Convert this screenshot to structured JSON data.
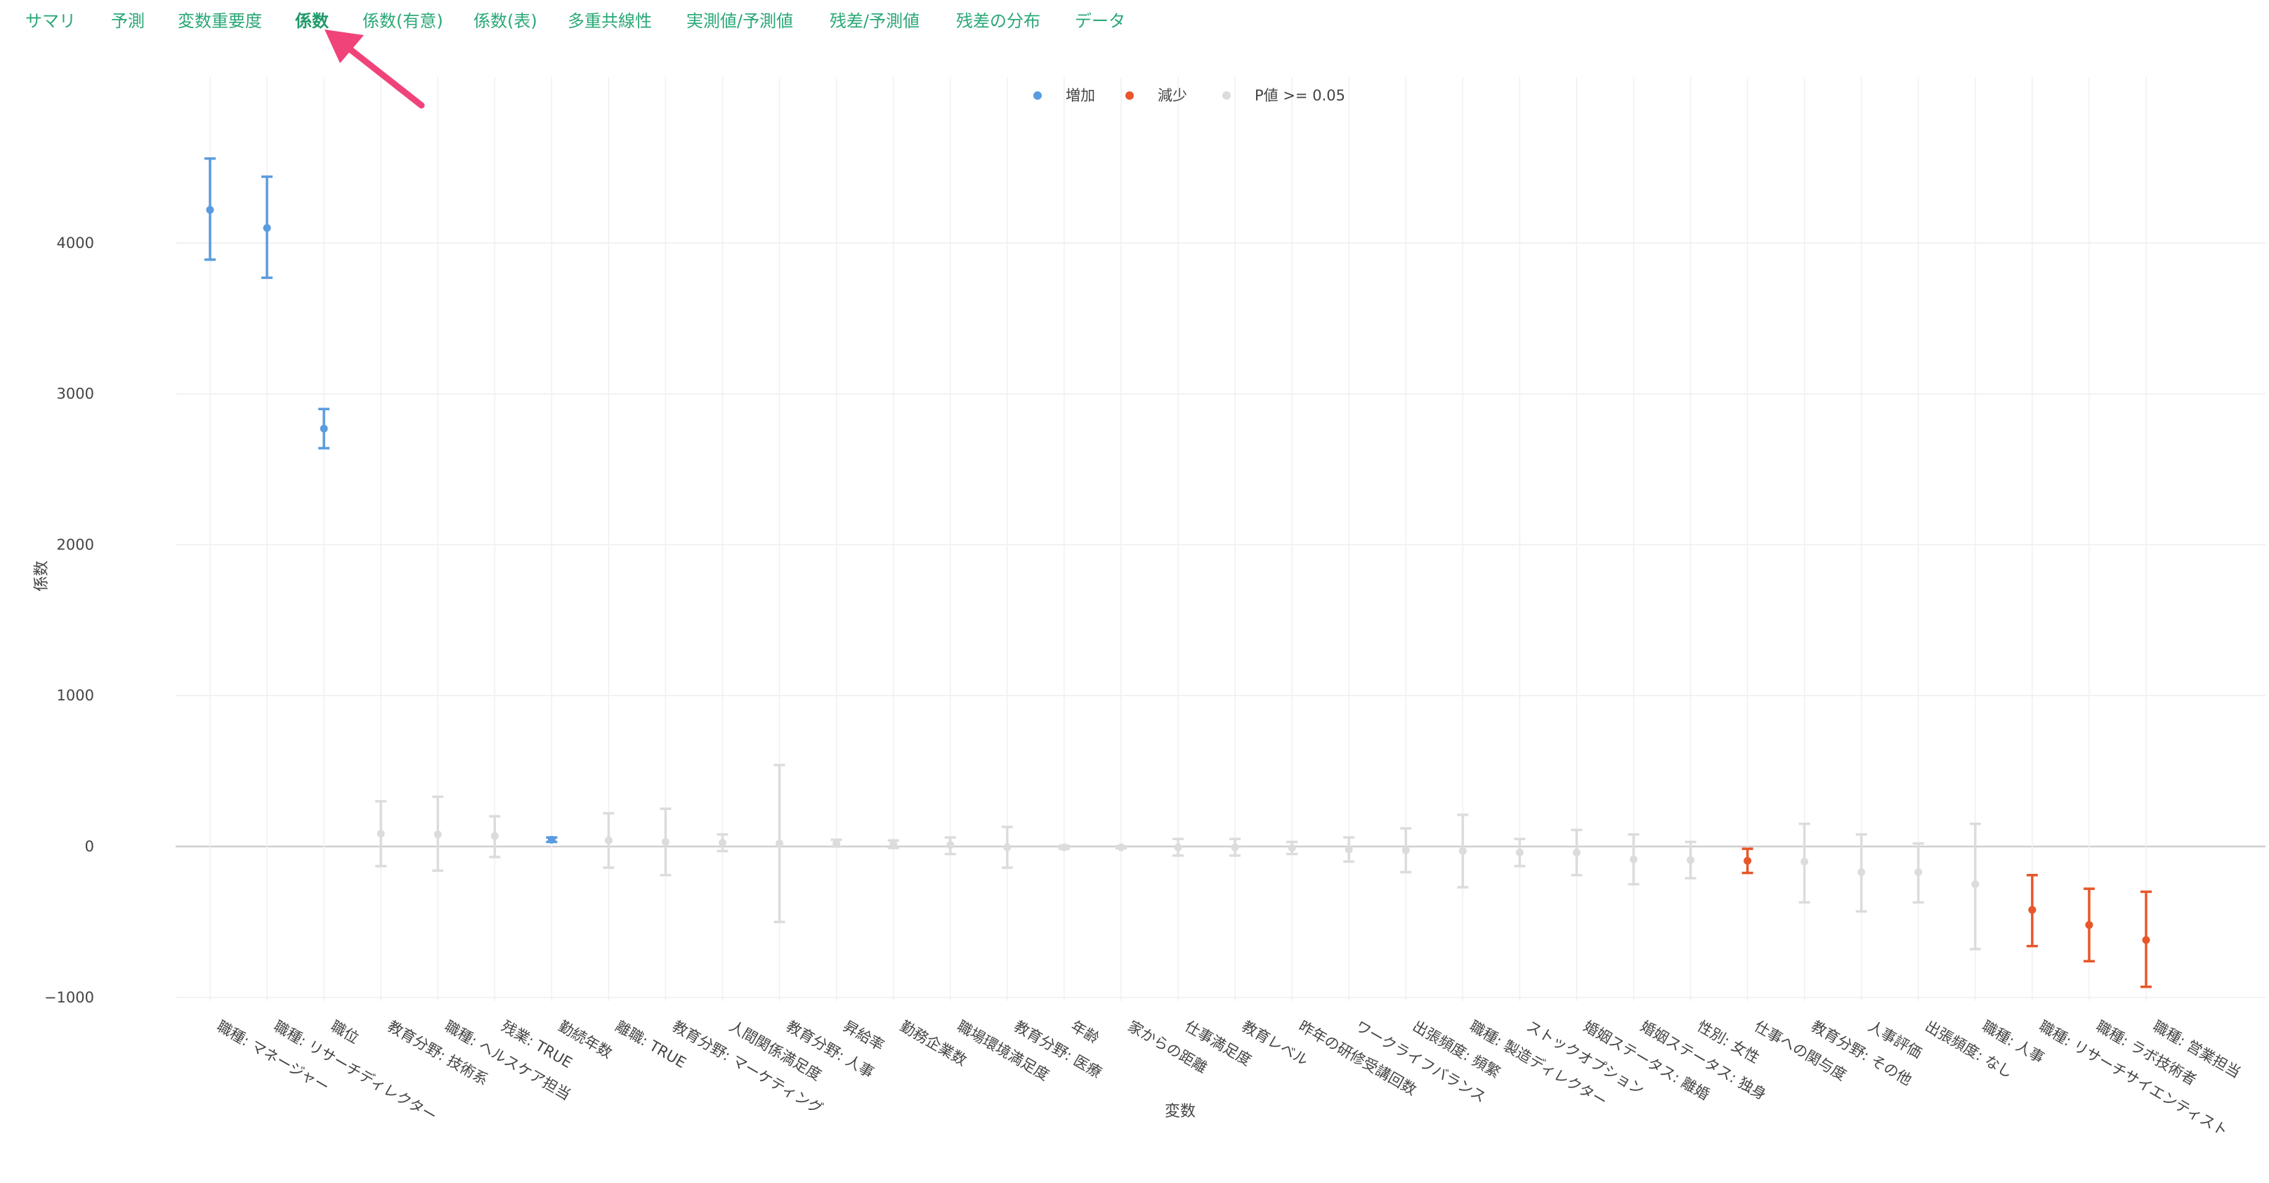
{
  "tabs": [
    {
      "label": "サマリ",
      "active": false
    },
    {
      "label": "予測",
      "active": false
    },
    {
      "label": "変数重要度",
      "active": false
    },
    {
      "label": "係数",
      "active": true
    },
    {
      "label": "係数(有意)",
      "active": false
    },
    {
      "label": "係数(表)",
      "active": false
    },
    {
      "label": "多重共線性",
      "active": false
    },
    {
      "label": "実測値/予測値",
      "active": false
    },
    {
      "label": "残差/予測値",
      "active": false
    },
    {
      "label": "残差の分布",
      "active": false
    },
    {
      "label": "データ",
      "active": false
    }
  ],
  "annotation": {
    "icon": "pointer-arrow-icon",
    "color": "#f0437a"
  },
  "chart_data": {
    "type": "errorbar",
    "title": "",
    "xlabel": "変数",
    "ylabel": "係数",
    "ylim": [
      -1000,
      4800
    ],
    "yticks": [
      -1000,
      0,
      1000,
      2000,
      3000,
      4000
    ],
    "grid": true,
    "legend": {
      "placement": "top-center",
      "entries": [
        {
          "name": "増加",
          "color": "#5b9bdf"
        },
        {
          "name": "減少",
          "color": "#e8562a"
        },
        {
          "name": "P値 >= 0.05",
          "color": "#dcdcdc"
        }
      ]
    },
    "colors": {
      "increase": "#5b9bdf",
      "decrease": "#e8562a",
      "insignificant": "#dcdcdc"
    },
    "points": [
      {
        "label": "職種: マネージャー",
        "value": 4220,
        "lower": 3890,
        "upper": 4560,
        "group": "increase"
      },
      {
        "label": "職種: リサーチディレクター",
        "value": 4100,
        "lower": 3770,
        "upper": 4440,
        "group": "increase"
      },
      {
        "label": "職位",
        "value": 2770,
        "lower": 2640,
        "upper": 2900,
        "group": "increase"
      },
      {
        "label": "教育分野: 技術系",
        "value": 85,
        "lower": -130,
        "upper": 300,
        "group": "insignificant"
      },
      {
        "label": "職種: ヘルスケア担当",
        "value": 80,
        "lower": -160,
        "upper": 330,
        "group": "insignificant"
      },
      {
        "label": "残業: TRUE",
        "value": 70,
        "lower": -70,
        "upper": 200,
        "group": "insignificant"
      },
      {
        "label": "勤続年数",
        "value": 45,
        "lower": 30,
        "upper": 60,
        "group": "increase"
      },
      {
        "label": "離職: TRUE",
        "value": 40,
        "lower": -140,
        "upper": 220,
        "group": "insignificant"
      },
      {
        "label": "教育分野: マーケティング",
        "value": 30,
        "lower": -190,
        "upper": 250,
        "group": "insignificant"
      },
      {
        "label": "人間関係満足度",
        "value": 25,
        "lower": -30,
        "upper": 80,
        "group": "insignificant"
      },
      {
        "label": "教育分野: 人事",
        "value": 20,
        "lower": -500,
        "upper": 540,
        "group": "insignificant"
      },
      {
        "label": "昇給率",
        "value": 20,
        "lower": 0,
        "upper": 45,
        "group": "insignificant"
      },
      {
        "label": "勤務企業数",
        "value": 15,
        "lower": -10,
        "upper": 40,
        "group": "insignificant"
      },
      {
        "label": "職場環境満足度",
        "value": 10,
        "lower": -50,
        "upper": 60,
        "group": "insignificant"
      },
      {
        "label": "教育分野: 医療",
        "value": -5,
        "lower": -140,
        "upper": 130,
        "group": "insignificant"
      },
      {
        "label": "年齢",
        "value": -5,
        "lower": -15,
        "upper": 5,
        "group": "insignificant"
      },
      {
        "label": "家からの距離",
        "value": -5,
        "lower": -12,
        "upper": 2,
        "group": "insignificant"
      },
      {
        "label": "仕事満足度",
        "value": -5,
        "lower": -60,
        "upper": 50,
        "group": "insignificant"
      },
      {
        "label": "教育レベル",
        "value": -5,
        "lower": -60,
        "upper": 50,
        "group": "insignificant"
      },
      {
        "label": "昨年の研修受講回数",
        "value": -10,
        "lower": -50,
        "upper": 30,
        "group": "insignificant"
      },
      {
        "label": "ワークライフバランス",
        "value": -20,
        "lower": -100,
        "upper": 60,
        "group": "insignificant"
      },
      {
        "label": "出張頻度: 頻繁",
        "value": -25,
        "lower": -170,
        "upper": 120,
        "group": "insignificant"
      },
      {
        "label": "職種: 製造ディレクター",
        "value": -30,
        "lower": -270,
        "upper": 210,
        "group": "insignificant"
      },
      {
        "label": "ストックオプション",
        "value": -40,
        "lower": -130,
        "upper": 50,
        "group": "insignificant"
      },
      {
        "label": "婚姻ステータス: 離婚",
        "value": -40,
        "lower": -190,
        "upper": 110,
        "group": "insignificant"
      },
      {
        "label": "婚姻ステータス: 独身",
        "value": -85,
        "lower": -250,
        "upper": 80,
        "group": "insignificant"
      },
      {
        "label": "性別: 女性",
        "value": -90,
        "lower": -210,
        "upper": 30,
        "group": "insignificant"
      },
      {
        "label": "仕事への関与度",
        "value": -95,
        "lower": -175,
        "upper": -15,
        "group": "decrease"
      },
      {
        "label": "教育分野: その他",
        "value": -100,
        "lower": -370,
        "upper": 150,
        "group": "insignificant"
      },
      {
        "label": "人事評価",
        "value": -170,
        "lower": -430,
        "upper": 80,
        "group": "insignificant"
      },
      {
        "label": "出張頻度: なし",
        "value": -170,
        "lower": -370,
        "upper": 20,
        "group": "insignificant"
      },
      {
        "label": "職種: 人事",
        "value": -250,
        "lower": -680,
        "upper": 150,
        "group": "insignificant"
      },
      {
        "label": "職種: リサーチサイエンティスト",
        "value": -420,
        "lower": -660,
        "upper": -190,
        "group": "decrease"
      },
      {
        "label": "職種: ラボ技術者",
        "value": -520,
        "lower": -760,
        "upper": -280,
        "group": "decrease"
      },
      {
        "label": "職種: 営業担当",
        "value": -620,
        "lower": -930,
        "upper": -300,
        "group": "decrease"
      }
    ]
  }
}
